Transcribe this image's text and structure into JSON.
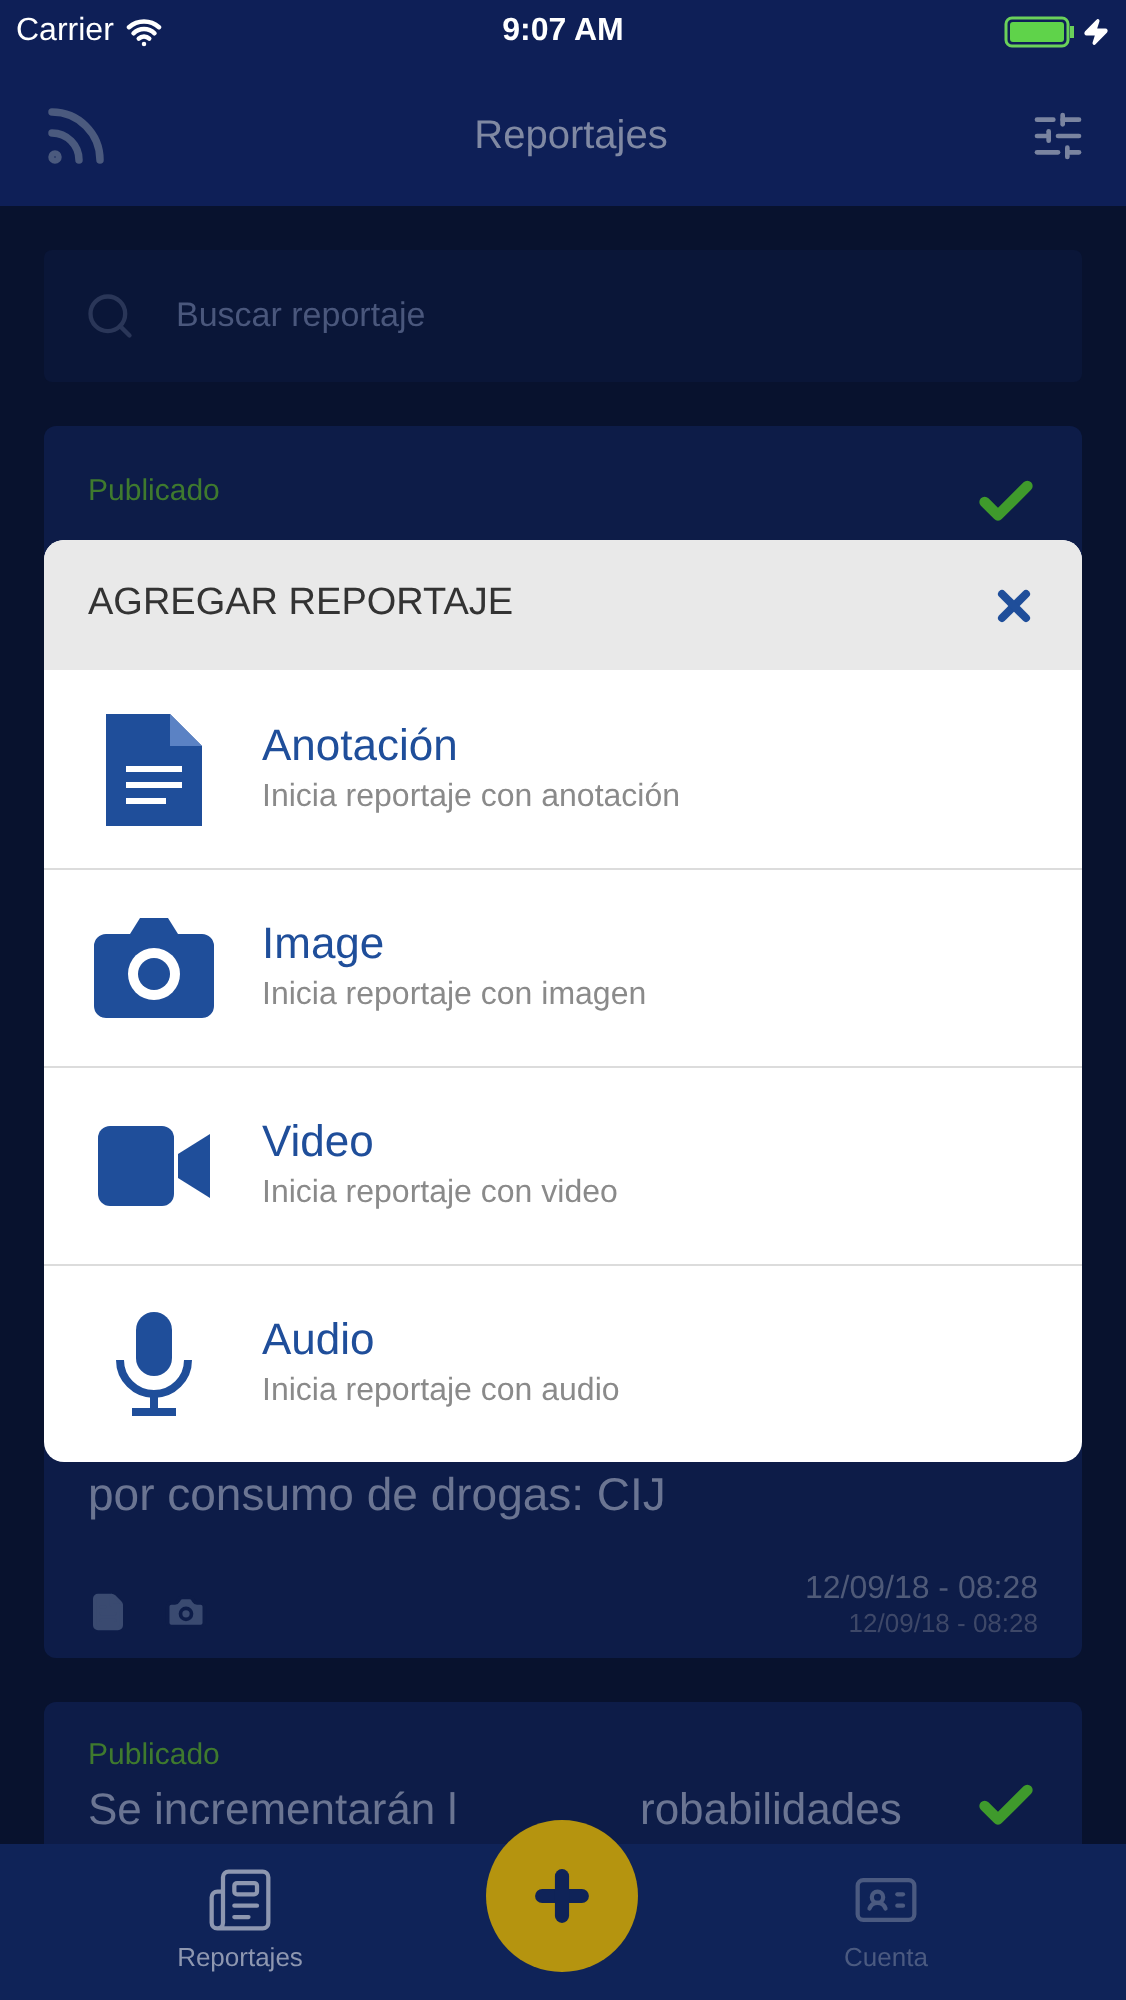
{
  "status_bar": {
    "carrier": "Carrier",
    "time": "9:07 AM"
  },
  "header": {
    "title": "Reportajes"
  },
  "search": {
    "placeholder": "Buscar reportaje"
  },
  "cards": [
    {
      "status": "Publicado",
      "title_lines": [
        "por consumo de drogas: CIJ"
      ],
      "published": true,
      "attachments": [
        {
          "kind": "note"
        },
        {
          "kind": "image"
        }
      ],
      "dates": [
        "12/09/18 - 08:28",
        "12/09/18 - 08:28"
      ]
    },
    {
      "status": "Publicado",
      "title_lines": [
        "Se incrementarán l",
        "robabilidades"
      ],
      "published": true
    }
  ],
  "modal": {
    "title": "AGREGAR REPORTAJE",
    "options": [
      {
        "kind": "note",
        "title": "Anotación",
        "subtitle": "Inicia reportaje con anotación"
      },
      {
        "kind": "image",
        "title": "Image",
        "subtitle": "Inicia reportaje con imagen"
      },
      {
        "kind": "video",
        "title": "Video",
        "subtitle": "Inicia reportaje con video"
      },
      {
        "kind": "audio",
        "title": "Audio",
        "subtitle": "Inicia reportaje con audio"
      }
    ]
  },
  "tab_bar": {
    "tabs": [
      {
        "kind": "news",
        "label": "Reportajes",
        "selected": true
      },
      {
        "kind": "account",
        "label": "Cuenta",
        "selected": false
      }
    ]
  }
}
